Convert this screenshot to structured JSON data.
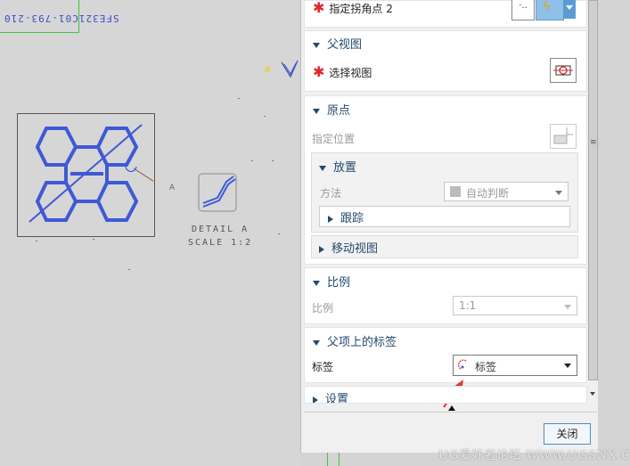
{
  "drawing": {
    "header_code": "SFE321C01-793-210",
    "view_leader": "A",
    "detail_title": "DETAIL A",
    "detail_scale": "SCALE 1:2",
    "hash_marks": "#"
  },
  "panel": {
    "top_row": {
      "label": "指定拐角点 2"
    },
    "parent_view": {
      "title": "父视图",
      "select_label": "选择视图"
    },
    "origin": {
      "title": "原点",
      "specify_location": "指定位置",
      "placement": {
        "title": "放置",
        "method_label": "方法",
        "method_value": "自动判断",
        "track_label": "跟踪"
      },
      "move_view": "移动视图"
    },
    "scale": {
      "title": "比例",
      "label": "比例",
      "value": "1:1"
    },
    "parent_label": {
      "title": "父项上的标签",
      "label": "标签",
      "value": "标签"
    },
    "settings": {
      "title": "设置"
    },
    "close_label": "关闭"
  },
  "watermark": "UG爱好者论坛 WWW.UGSNX.COM",
  "colors": {
    "accent_red": "#e0262b",
    "section_title": "#234a6c",
    "drawing_blue": "#3c4fc9"
  }
}
